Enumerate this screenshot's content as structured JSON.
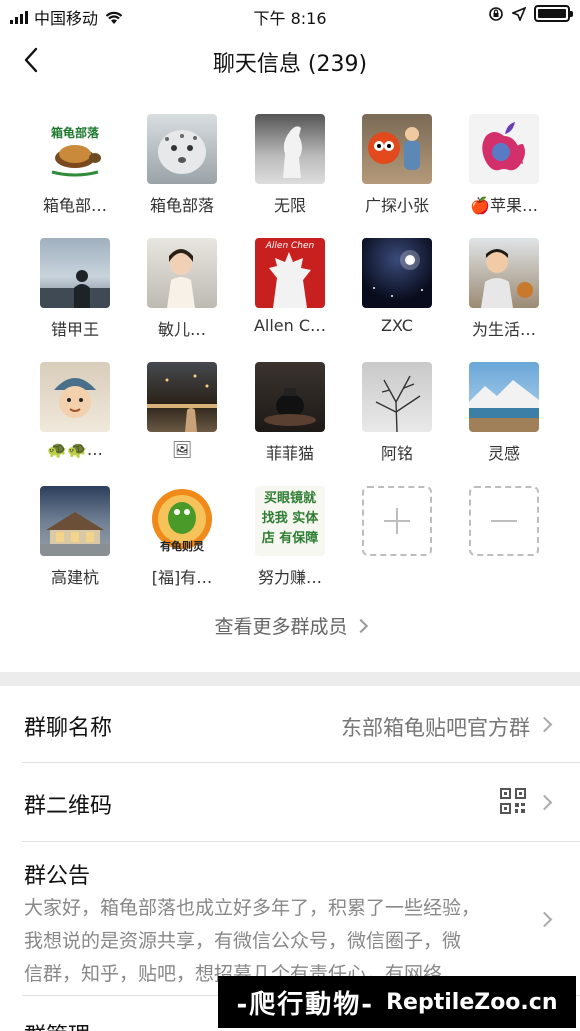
{
  "status_bar": {
    "carrier": "中国移动",
    "time": "下午 8:16"
  },
  "nav": {
    "title": "聊天信息 (239)"
  },
  "members": [
    {
      "name": "箱龟部…",
      "avatar_icon": "turtle-logo",
      "avatar_text": "箱龟部落"
    },
    {
      "name": "箱龟部落",
      "avatar_icon": "snow-leopard"
    },
    {
      "name": "无限",
      "avatar_icon": "white-horse"
    },
    {
      "name": "广探小张",
      "avatar_icon": "cartoon-fox"
    },
    {
      "name": "🍎苹果…",
      "avatar_icon": "apple-logo"
    },
    {
      "name": "错甲王",
      "avatar_icon": "silhouette-sky"
    },
    {
      "name": "敏儿…",
      "avatar_icon": "child-photo"
    },
    {
      "name": "Allen C…",
      "avatar_icon": "godzilla",
      "avatar_text": "Allen Chen"
    },
    {
      "name": "ZXC",
      "avatar_icon": "night-star"
    },
    {
      "name": "为生活…",
      "avatar_icon": "boy-photo"
    },
    {
      "name": "🐢🐢…",
      "avatar_icon": "baby-photo"
    },
    {
      "name": "🖼",
      "avatar_icon": "city-night"
    },
    {
      "name": "菲菲猫",
      "avatar_icon": "teapot"
    },
    {
      "name": "阿铭",
      "avatar_icon": "tree-branches"
    },
    {
      "name": "灵感",
      "avatar_icon": "mountain-lake"
    },
    {
      "name": "高建杭",
      "avatar_icon": "building"
    },
    {
      "name": "[福]有…",
      "avatar_icon": "turtle-cartoon",
      "avatar_text": "有龟则灵"
    },
    {
      "name": "努力赚…",
      "avatar_icon": "ad-sign",
      "avatar_text": "买眼镜就找我 实体店 有保障"
    }
  ],
  "add_member_icon": "plus-icon",
  "remove_member_icon": "minus-icon",
  "more_members": "查看更多群成员",
  "group_name": {
    "label": "群聊名称",
    "value": "东部箱龟贴吧官方群"
  },
  "qr_code": {
    "label": "群二维码",
    "icon": "qr-code-icon"
  },
  "announcement": {
    "label": "群公告",
    "text_lines": [
      "大家好，箱龟部落也成立好多年了，积累了一些经验，",
      "我想说的是资源共享，有微信公众号，微信圈子，微",
      "信群，知乎，贴吧，想招募几个有责任心，有网络"
    ]
  },
  "next_row": {
    "label": "群管理"
  },
  "watermark": {
    "cn": "-爬行動物-",
    "en": "ReptileZoo.cn"
  }
}
